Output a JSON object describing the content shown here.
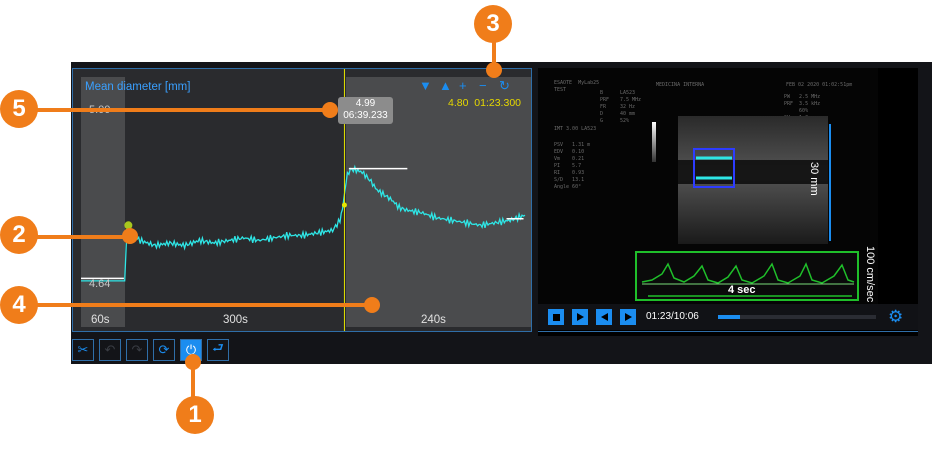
{
  "chart": {
    "title": "Mean diameter [mm]",
    "y_top_label": "5.00",
    "y_bottom_label": "4.64",
    "cursor_value": "4.99",
    "cursor_time": "06:39.233",
    "current_value": "4.80",
    "current_time": "01:23.300",
    "segments": [
      "60s",
      "300s",
      "240s"
    ],
    "controls": [
      {
        "name": "down-arrow-icon",
        "glyph": "▼"
      },
      {
        "name": "up-arrow-icon",
        "glyph": "▲"
      },
      {
        "name": "zoom-in-icon",
        "glyph": "+"
      },
      {
        "name": "zoom-out-icon",
        "glyph": "−"
      },
      {
        "name": "refresh-icon",
        "glyph": "↻"
      }
    ]
  },
  "chart_data": {
    "type": "line",
    "title": "Mean diameter [mm]",
    "xlabel": "",
    "ylabel": "",
    "ylim": [
      4.64,
      5.0
    ],
    "x_unit": "s",
    "x_range": [
      0,
      600
    ],
    "segments": [
      {
        "label": "60s",
        "start": 0,
        "end": 60
      },
      {
        "label": "300s",
        "start": 60,
        "end": 360
      },
      {
        "label": "240s",
        "start": 360,
        "end": 600
      }
    ],
    "series": [
      {
        "x": [
          0,
          20,
          40,
          59,
          62,
          64,
          70,
          80,
          100,
          120,
          140,
          160,
          180,
          200,
          220,
          240,
          260,
          280,
          300,
          320,
          340,
          350,
          355,
          360,
          364,
          370,
          380,
          390,
          400,
          410,
          420,
          430,
          440,
          460,
          480,
          500,
          520,
          540,
          560,
          580,
          600
        ],
        "y": [
          4.66,
          4.66,
          4.66,
          4.66,
          4.76,
          4.77,
          4.75,
          4.74,
          4.73,
          4.735,
          4.73,
          4.74,
          4.735,
          4.74,
          4.745,
          4.74,
          4.745,
          4.75,
          4.75,
          4.755,
          4.76,
          4.78,
          4.82,
          4.87,
          4.88,
          4.88,
          4.875,
          4.86,
          4.84,
          4.83,
          4.82,
          4.805,
          4.8,
          4.795,
          4.785,
          4.78,
          4.775,
          4.77,
          4.775,
          4.78,
          4.79
        ]
      }
    ],
    "cursor": {
      "x": 356,
      "y": 4.99,
      "time": "06:39.233"
    },
    "grid": false
  },
  "toolbar": [
    {
      "name": "cut-button",
      "glyph": "✂",
      "enabled": true
    },
    {
      "name": "undo-button",
      "glyph": "↶",
      "enabled": false
    },
    {
      "name": "redo-button",
      "glyph": "↷",
      "enabled": false
    },
    {
      "name": "sync-button",
      "glyph": "⟳",
      "enabled": true
    },
    {
      "name": "power-button",
      "glyph": "⏻",
      "enabled": true,
      "active": true
    },
    {
      "name": "loop-button",
      "glyph": "⮐",
      "enabled": true
    }
  ],
  "video": {
    "scale_label": "30 mm",
    "doppler_scale_label": "100 cm/sec",
    "doppler_time_label": "4 sec",
    "header_left": "MEDICINA INTERNA",
    "header_right": "FEB 02 2020 01:02:51pm"
  },
  "player": {
    "time": "01:23/10:06",
    "progress": 0.137
  },
  "callouts": [
    "1",
    "2",
    "3",
    "4",
    "5"
  ],
  "colors": {
    "accent": "#1b8df0",
    "trace": "#2ee6e6",
    "cursor": "#e6e600",
    "callout": "#f07d1a"
  }
}
